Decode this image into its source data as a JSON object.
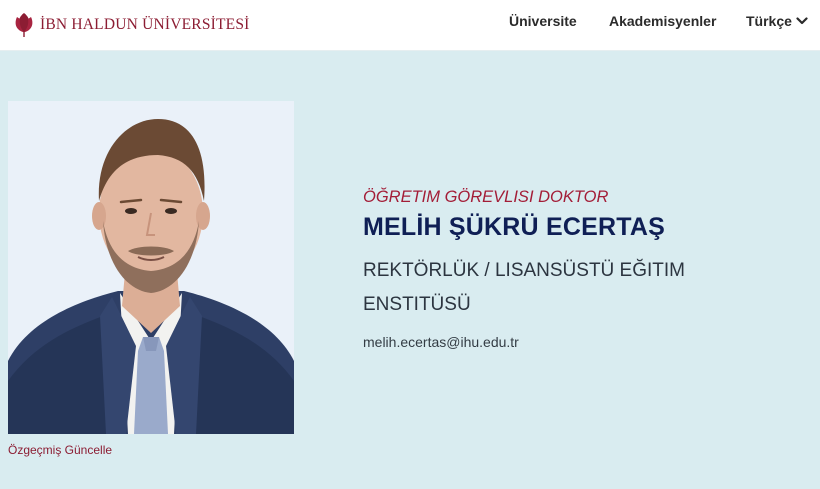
{
  "header": {
    "brand": "İBN HALDUN ÜNİVERSİTESİ",
    "logo_icon": "tulip-logo-icon",
    "brand_color": "#8c1d33",
    "nav": [
      {
        "label": "Üniversite"
      },
      {
        "label": "Akademisyenler"
      }
    ],
    "language": {
      "label": "Türkçe",
      "icon": "chevron-down-icon"
    }
  },
  "profile": {
    "photo_icon": "profile-photo",
    "update_link": "Özgeçmiş Güncelle",
    "title": "ÖĞRETIM GÖREVLISI DOKTOR",
    "name": "MELİH ŞÜKRÜ ECERTAŞ",
    "department": "REKTÖRLÜK / LISANSÜSTÜ EĞITIM ENSTITÜSÜ",
    "email": "melih.ecertas@ihu.edu.tr"
  },
  "colors": {
    "background": "#d9ecf0",
    "accent": "#a31d37",
    "name": "#0f1f55"
  }
}
